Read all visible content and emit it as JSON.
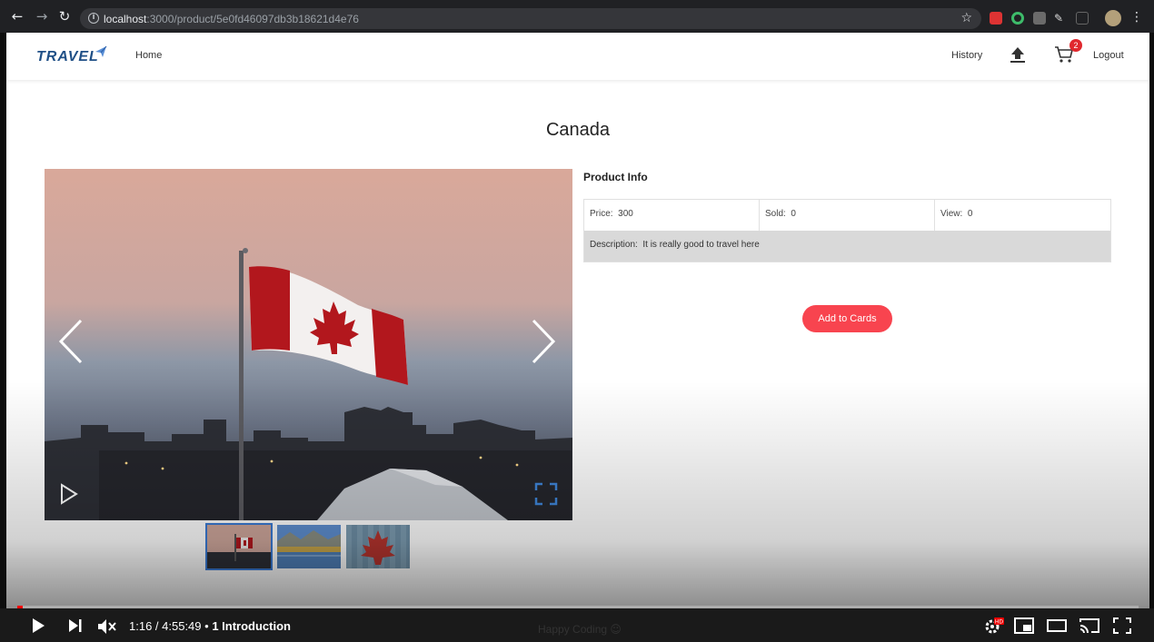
{
  "browser": {
    "url_host": "localhost",
    "url_rest": ":3000/product/5e0fd46097db3b18621d4e76"
  },
  "nav": {
    "logo": "TRAVEL",
    "home": "Home",
    "history": "History",
    "cart_count": "2",
    "logout": "Logout"
  },
  "product": {
    "title": "Canada",
    "info_title": "Product Info",
    "price_label": "Price",
    "price_value": "300",
    "sold_label": "Sold",
    "sold_value": "0",
    "view_label": "View",
    "view_value": "0",
    "description_label": "Description",
    "description_value": "It is really good to travel here",
    "add_button": "Add to Cards"
  },
  "video": {
    "time": "1:16 / 4:55:49",
    "separator": "•",
    "chapter": "1 Introduction",
    "progress": 0.0043,
    "watermark": "Happy Coding"
  },
  "colors": {
    "accent": "#f8444f",
    "logo": "#1f4f86",
    "badge": "#e0282e"
  }
}
